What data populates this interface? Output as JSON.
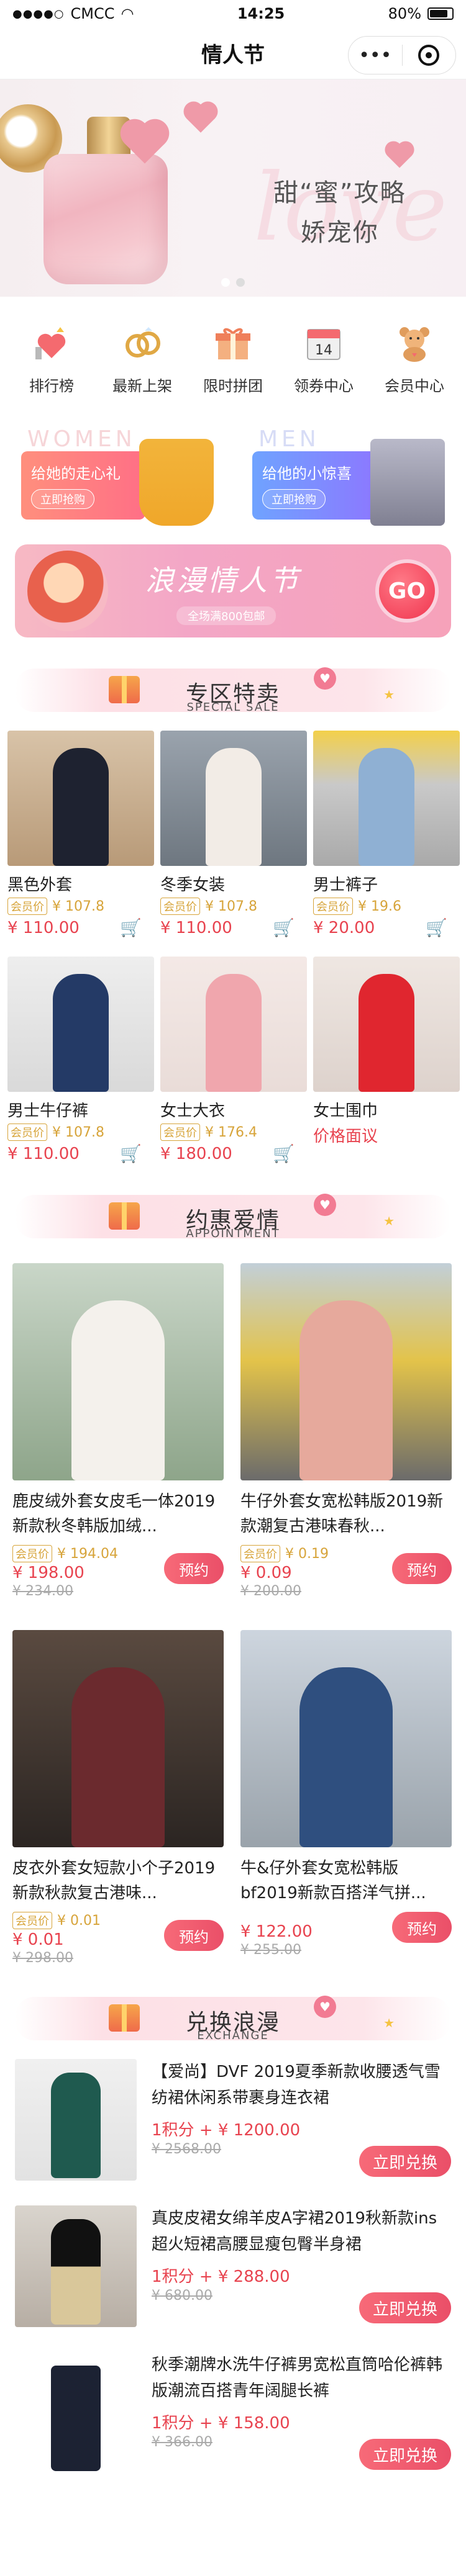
{
  "status_bar": {
    "carrier": "CMCC",
    "time": "14:25",
    "battery": "80%"
  },
  "nav": {
    "title": "情人节"
  },
  "banner": {
    "watermark": "love",
    "line1": "甜“蜜”攻略",
    "line2": "娇宠你"
  },
  "quick_nav": [
    {
      "label": "排行榜",
      "icon": "heart-chart-icon"
    },
    {
      "label": "最新上架",
      "icon": "rings-icon"
    },
    {
      "label": "限时拼团",
      "icon": "gift-box-icon"
    },
    {
      "label": "领券中心",
      "icon": "calendar-icon",
      "badge": "14"
    },
    {
      "label": "会员中心",
      "icon": "teddy-bear-icon"
    }
  ],
  "gifts": {
    "women": {
      "bg_word": "WOMEN",
      "title": "给她的走心礼",
      "button": "立即抢购"
    },
    "men": {
      "bg_word": "MEN",
      "title": "给他的小惊喜",
      "button": "立即抢购"
    }
  },
  "valentine_banner": {
    "title": "浪漫情人节",
    "subtitle": "全场满800包邮",
    "go": "GO"
  },
  "special": {
    "title": "专区特卖",
    "subtitle": "SPECIAL SALE",
    "vip_tag": "会员价",
    "items": [
      {
        "name": "黑色外套",
        "vip_price": "¥ 107.8",
        "price": "¥ 110.00"
      },
      {
        "name": "冬季女装",
        "vip_price": "¥ 107.8",
        "price": "¥ 110.00"
      },
      {
        "name": "男士裤子",
        "vip_price": "¥ 19.6",
        "price": "¥ 20.00"
      },
      {
        "name": "男士牛仔裤",
        "vip_price": "¥ 107.8",
        "price": "¥ 110.00"
      },
      {
        "name": "女士大衣",
        "vip_price": "¥ 176.4",
        "price": "¥ 180.00"
      },
      {
        "name": "女士围巾",
        "negotiable": "价格面议"
      }
    ]
  },
  "appointment": {
    "title": "约惠爱情",
    "subtitle": "APPOINTMENT",
    "vip_tag": "会员价",
    "book_label": "预约",
    "items": [
      {
        "title": "鹿皮绒外套女皮毛一体2019新款秋冬韩版加绒...",
        "vip_price": "¥ 194.04",
        "price": "¥ 198.00",
        "original": "¥ 234.00"
      },
      {
        "title": "牛仔外套女宽松韩版2019新款潮复古港味春秋...",
        "vip_price": "¥ 0.19",
        "price": "¥ 0.09",
        "original": "¥ 200.00"
      },
      {
        "title": "皮衣外套女短款小个子2019新款秋款复古港味...",
        "vip_price": "¥ 0.01",
        "price": "¥ 0.01",
        "original": "¥ 298.00"
      },
      {
        "title": "牛&仔外套女宽松韩版bf2019新款百搭洋气拼...",
        "price": "¥ 122.00",
        "original": "¥ 255.00"
      }
    ]
  },
  "exchange": {
    "title": "兑换浪漫",
    "subtitle": "EXCHANGE",
    "button_label": "立即兑换",
    "items": [
      {
        "title": "【爱尚】DVF 2019夏季新款收腰透气雪纺裙休闲系带裹身连衣裙",
        "price": "1积分 + ¥ 1200.00",
        "original": "¥ 2568.00"
      },
      {
        "title": "真皮皮裙女绵羊皮A字裙2019秋新款ins超火短裙高腰显瘦包臀半身裙",
        "price": "1积分 + ¥ 288.00",
        "original": "¥ 680.00"
      },
      {
        "title": "秋季潮牌水洗牛仔裤男宽松直筒哈伦裤韩版潮流百搭青年阔腿长裤",
        "price": "1积分 + ¥ 158.00",
        "original": "¥ 366.00"
      }
    ]
  },
  "colors": {
    "accent_red": "#e8434f",
    "vip_gold": "#d7a43a",
    "button_pink": "#ea4f68"
  }
}
